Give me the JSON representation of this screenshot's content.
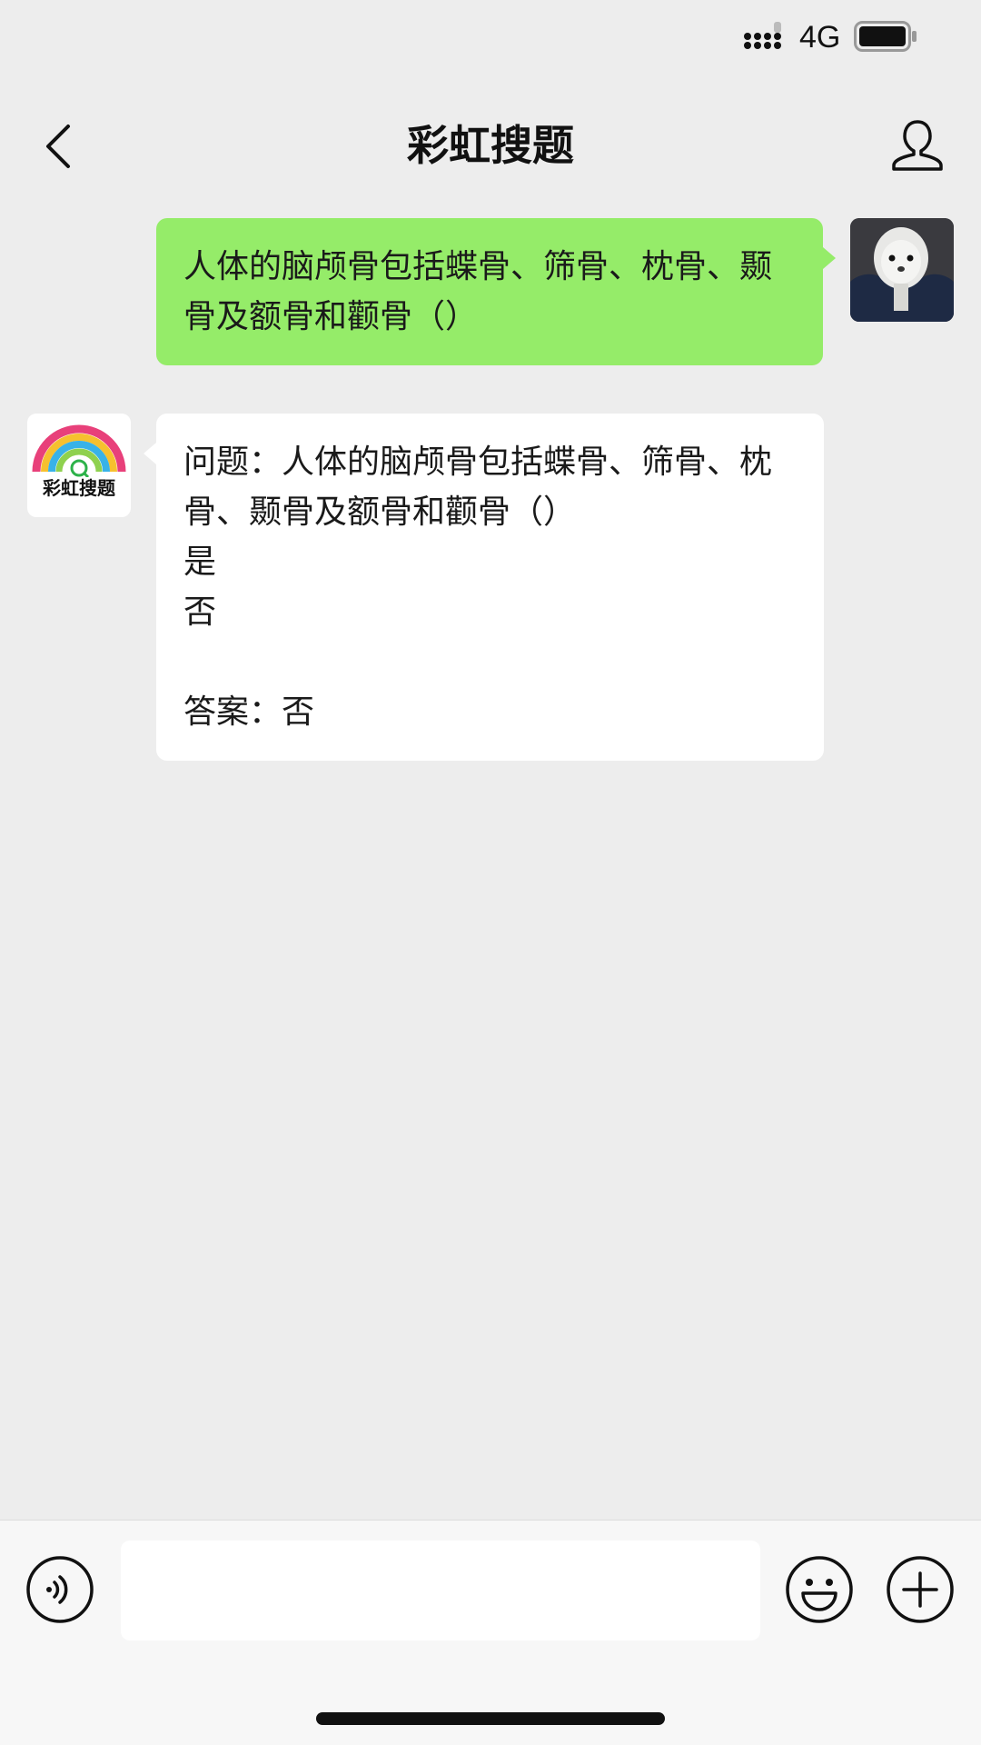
{
  "status_bar": {
    "network": "4G",
    "icons": [
      "signal-icon",
      "battery-icon"
    ]
  },
  "nav": {
    "title": "彩虹搜题",
    "icons": [
      "back-arrow-icon",
      "profile-icon"
    ]
  },
  "messages": [
    {
      "sender": "user",
      "text": "人体的脑颅骨包括蝶骨、筛骨、枕骨、颞骨及额骨和颧骨（）"
    },
    {
      "sender": "bot",
      "bot_name": "彩虹搜题",
      "lines": [
        "问题：人体的脑颅骨包括蝶骨、筛骨、枕骨、颞骨及额骨和颧骨（）",
        "是",
        "否",
        "",
        "答案：否"
      ]
    }
  ],
  "input_bar": {
    "placeholder": "",
    "icons": [
      "voice-icon",
      "emoji-icon",
      "plus-icon"
    ]
  },
  "colors": {
    "background": "#ededed",
    "user_bubble": "#95ec69",
    "bot_bubble": "#ffffff",
    "input_bar": "#f7f7f7"
  }
}
